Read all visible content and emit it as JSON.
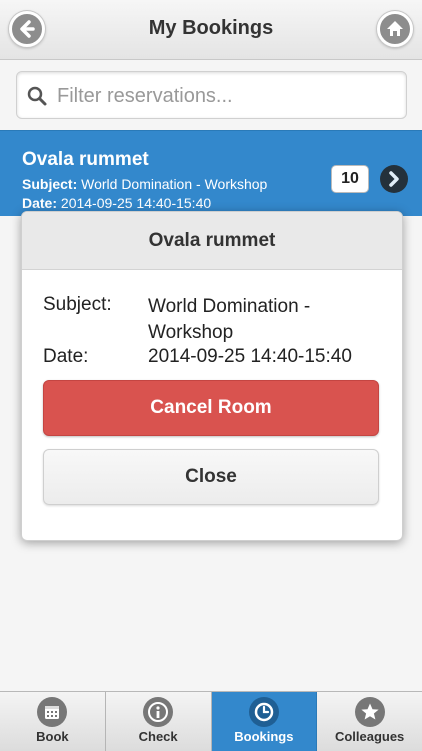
{
  "header": {
    "title": "My Bookings",
    "back_icon": "back-arrow-icon",
    "home_icon": "home-icon"
  },
  "search": {
    "placeholder": "Filter reservations...",
    "value": "",
    "icon": "search-icon"
  },
  "list": {
    "items": [
      {
        "title": "Ovala rummet",
        "subject_label": "Subject:",
        "subject_value": "World Domination - Workshop",
        "date_label": "Date:",
        "date_value": "2014-09-25 14:40-15:40",
        "count": "10",
        "selected": true
      }
    ]
  },
  "popup": {
    "title": "Ovala rummet",
    "subject_label": "Subject:",
    "subject_value": "World Domination - Workshop",
    "date_label": "Date:",
    "date_value": "2014-09-25 14:40-15:40",
    "cancel_label": "Cancel Room",
    "close_label": "Close"
  },
  "tabs": [
    {
      "label": "Book",
      "icon": "calendar-icon",
      "active": false
    },
    {
      "label": "Check",
      "icon": "info-icon",
      "active": false
    },
    {
      "label": "Bookings",
      "icon": "clock-icon",
      "active": true
    },
    {
      "label": "Colleagues",
      "icon": "star-icon",
      "active": false
    }
  ],
  "colors": {
    "accent": "#3388cc",
    "danger": "#d9534f"
  }
}
